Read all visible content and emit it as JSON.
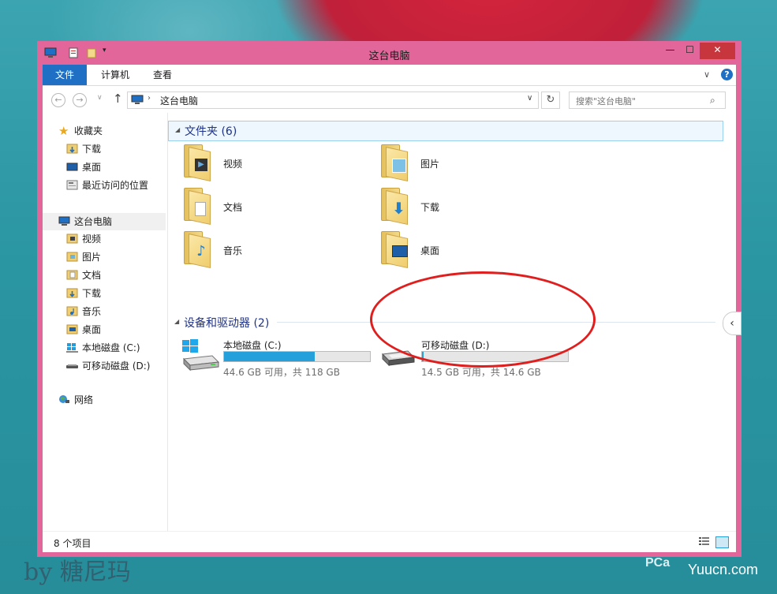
{
  "window": {
    "title": "这台电脑",
    "minimize_glyph": "—",
    "maximize_glyph": "☐",
    "close_glyph": "✕"
  },
  "ribbon": {
    "tabs": [
      "文件",
      "计算机",
      "查看"
    ],
    "expand_glyph": "∨",
    "help_glyph": "?"
  },
  "address": {
    "back_glyph": "←",
    "forward_glyph": "→",
    "recent_glyph": "∨",
    "up_glyph": "↑",
    "separator": "›",
    "path": "这台电脑",
    "dropdown_glyph": "∨",
    "refresh_glyph": "↻",
    "search_placeholder": "搜索\"这台电脑\"",
    "search_glyph": "⌕"
  },
  "nav_pane": {
    "favorites": {
      "label": "收藏夹",
      "items": [
        "下载",
        "桌面",
        "最近访问的位置"
      ]
    },
    "this_pc": {
      "label": "这台电脑",
      "items": [
        "视频",
        "图片",
        "文档",
        "下载",
        "音乐",
        "桌面",
        "本地磁盘 (C:)",
        "可移动磁盘 (D:)"
      ]
    },
    "network": {
      "label": "网络"
    }
  },
  "main": {
    "folders_group": "文件夹 (6)",
    "folders": [
      {
        "name": "视频",
        "icon": "video-folder-icon"
      },
      {
        "name": "图片",
        "icon": "pictures-folder-icon"
      },
      {
        "name": "文档",
        "icon": "documents-folder-icon"
      },
      {
        "name": "下载",
        "icon": "downloads-folder-icon"
      },
      {
        "name": "音乐",
        "icon": "music-folder-icon"
      },
      {
        "name": "桌面",
        "icon": "desktop-folder-icon"
      }
    ],
    "devices_group": "设备和驱动器 (2)",
    "drives": [
      {
        "name": "本地磁盘 (C:)",
        "info": "44.6 GB 可用，共 118 GB",
        "used_fraction": 0.622
      },
      {
        "name": "可移动磁盘 (D:)",
        "info": "14.5 GB 可用，共 14.6 GB",
        "used_fraction": 0.007
      }
    ],
    "group_arrow_glyph": "◢",
    "side_arrow_glyph": "‹"
  },
  "status": {
    "item_count": "8 个项目"
  },
  "watermarks": {
    "left": "by 糖尼玛",
    "right_logo": "PCa",
    "right_site": "Yuucn.com"
  },
  "colors": {
    "window_frame": "#e3669a",
    "accent_blue": "#1f6fc5",
    "drive_bar_fill": "#26a0da",
    "close_button": "#c7353d",
    "highlight_ellipse": "#e01e1e"
  }
}
